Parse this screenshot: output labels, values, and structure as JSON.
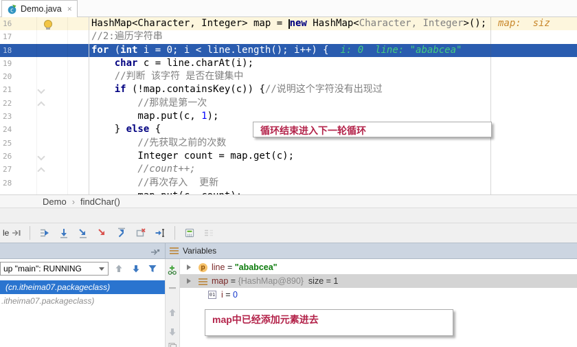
{
  "tab": {
    "title": "Demo.java",
    "close_glyph": "×"
  },
  "breadcrumb": {
    "class_name": "Demo",
    "separator": "›",
    "method": "findChar()"
  },
  "annotations": {
    "loop_note": "循环结束进入下一轮循环",
    "map_note": "map中已经添加元素进去"
  },
  "editor": {
    "lines": [
      {
        "num": "16",
        "bg": "bg-current",
        "icon": "lightbulb",
        "tokens": [
          [
            "p",
            "HashMap<Character, Integer> map = "
          ],
          [
            "caret",
            ""
          ],
          [
            "kw",
            "new"
          ],
          [
            "p",
            " HashMap<"
          ],
          [
            "gr",
            "Character, Integer"
          ],
          [
            "p",
            ">();"
          ],
          [
            "hint-o",
            "  map:  siz"
          ]
        ]
      },
      {
        "num": "17",
        "tokens": [
          [
            "cm",
            "//2:遍历字符串"
          ]
        ]
      },
      {
        "num": "18",
        "bg": "bg-exec",
        "tokens": [
          [
            "kww",
            "for"
          ],
          [
            "pw",
            " ("
          ],
          [
            "kww",
            "int"
          ],
          [
            "pw",
            " i = 0; i < line.length(); i++) {"
          ],
          [
            "hint-g",
            "  i: 0  line: \"ababcea\""
          ]
        ]
      },
      {
        "num": "19",
        "tokens": [
          [
            "p",
            "    "
          ],
          [
            "kw",
            "char"
          ],
          [
            "p",
            " c = line.charAt(i);"
          ]
        ]
      },
      {
        "num": "20",
        "tokens": [
          [
            "cm",
            "    //判断 该字符 是否在键集中"
          ]
        ]
      },
      {
        "num": "21",
        "icon": "fold-down",
        "tokens": [
          [
            "p",
            "    "
          ],
          [
            "kw",
            "if"
          ],
          [
            "p",
            " (!map.containsKey(c)) {"
          ],
          [
            "cm",
            "//说明这个字符没有出现过"
          ]
        ]
      },
      {
        "num": "22",
        "icon": "fold-up",
        "tokens": [
          [
            "cm",
            "        //那就是第一次"
          ]
        ]
      },
      {
        "num": "23",
        "tokens": [
          [
            "p",
            "        map.put(c, "
          ],
          [
            "num",
            "1"
          ],
          [
            "p",
            ");"
          ]
        ]
      },
      {
        "num": "24",
        "tokens": [
          [
            "p",
            "    } "
          ],
          [
            "kw",
            "else"
          ],
          [
            "p",
            " {"
          ]
        ]
      },
      {
        "num": "25",
        "tokens": [
          [
            "cm",
            "        //先获取之前的次数"
          ]
        ]
      },
      {
        "num": "26",
        "icon": "fold-down",
        "tokens": [
          [
            "p",
            "        Integer count = map.get(c);"
          ]
        ]
      },
      {
        "num": "27",
        "icon": "fold-up",
        "tokens": [
          [
            "cmi",
            "        //count++;"
          ]
        ]
      },
      {
        "num": "28",
        "tokens": [
          [
            "cm",
            "        //再次存入  更新"
          ]
        ]
      },
      {
        "num": "",
        "tokens": [
          [
            "p",
            "        map.put(c, count);"
          ]
        ]
      }
    ]
  },
  "debug": {
    "console_tab_partial": "le",
    "variables_label": "Variables",
    "threads_dropdown": "up \"main\": RUNNING",
    "frames": [
      {
        "text": "(cn.itheima07.packageclass)",
        "selected": true
      },
      {
        "text": ".itheima07.packageclass)",
        "selected": false
      }
    ],
    "variables": [
      {
        "icon": "param",
        "icon_text": "p",
        "chevron": true,
        "selected": false,
        "indent": 0,
        "parts": [
          [
            "name",
            "line"
          ],
          [
            "op",
            " = "
          ],
          [
            "vstr",
            "\"ababcea\""
          ]
        ]
      },
      {
        "icon": "list",
        "icon_text": "",
        "chevron": true,
        "selected": true,
        "indent": 0,
        "parts": [
          [
            "name",
            "map"
          ],
          [
            "op",
            " = "
          ],
          [
            "vref",
            "{HashMap@890} "
          ],
          [
            "plain",
            " size = 1"
          ]
        ]
      },
      {
        "icon": "prim",
        "icon_text": "01",
        "chevron": false,
        "selected": false,
        "indent": 1,
        "parts": [
          [
            "name",
            "i"
          ],
          [
            "op",
            " = "
          ],
          [
            "vnum",
            "0"
          ]
        ]
      }
    ],
    "step_toolbar_icons": [
      "show-execution-point",
      "step-over",
      "step-into",
      "force-step-into",
      "step-out",
      "drop-frame",
      "run-to-cursor",
      "evaluate-expression",
      "inline-values"
    ],
    "frames_toolbar_icons": [
      "navigate-up",
      "navigate-down",
      "filter-threads"
    ],
    "watch_toolbar_icons": [
      "add-watch",
      "remove-watch",
      "move-up",
      "move-down",
      "duplicate"
    ]
  },
  "colors": {
    "execution_line": "#2a5caf",
    "selected_frame": "#2a74cf",
    "current_line": "#fdf6dd",
    "annotation_text": "#b3234a",
    "hint_green": "#45cd80",
    "hint_orange": "#c8872b"
  }
}
